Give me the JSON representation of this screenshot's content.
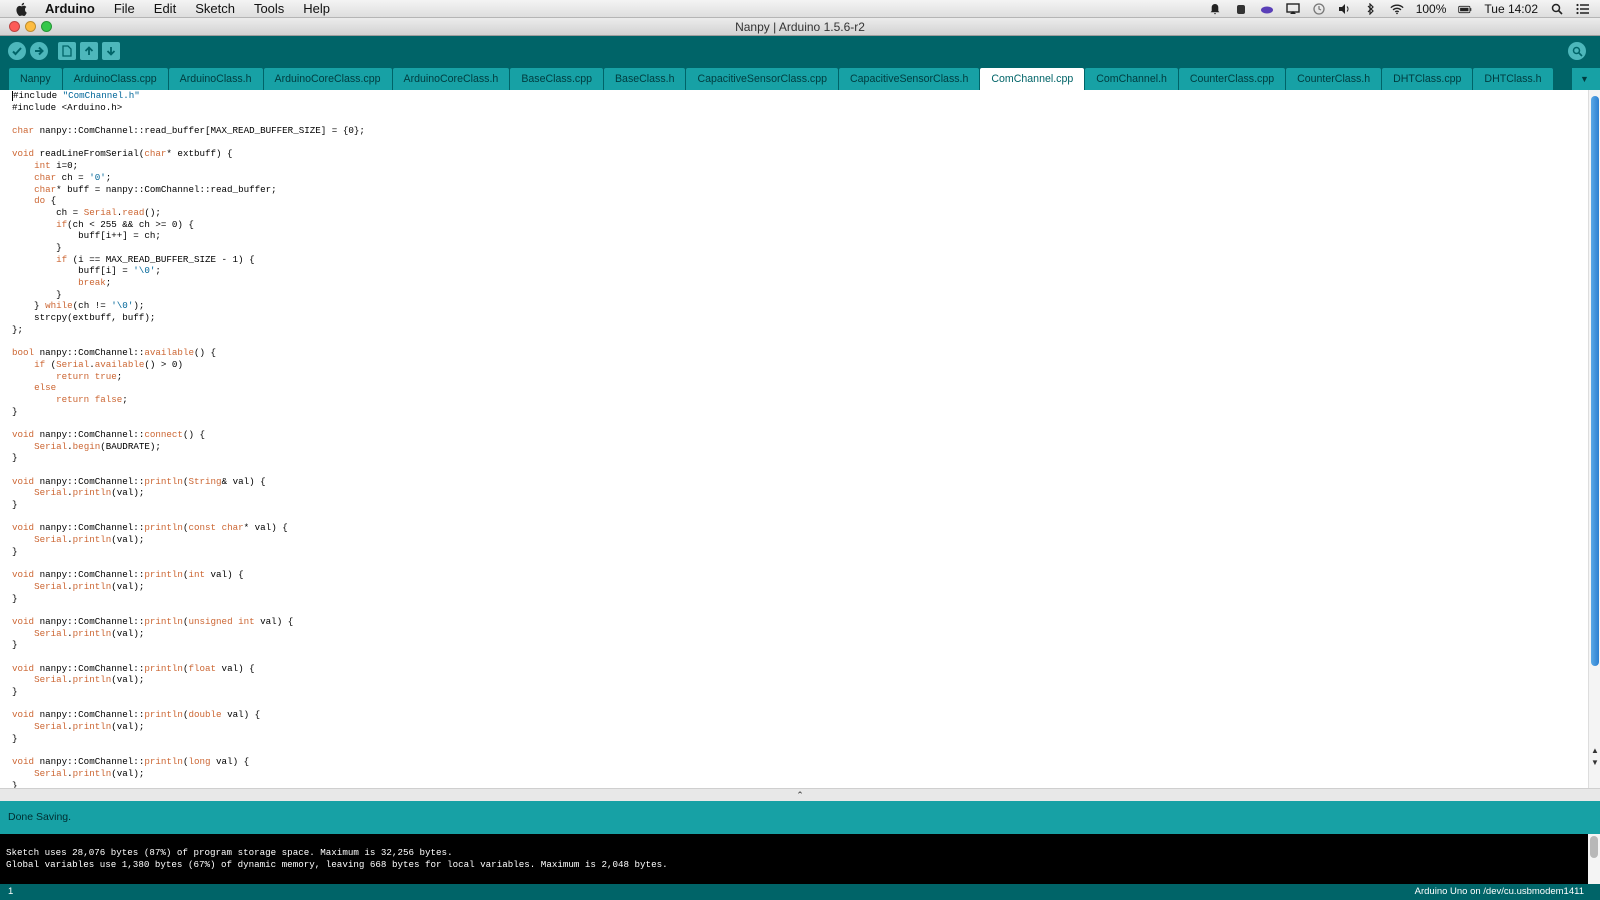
{
  "menubar": {
    "app": "Arduino",
    "items": [
      "File",
      "Edit",
      "Sketch",
      "Tools",
      "Help"
    ],
    "battery": "100%",
    "clock": "Tue 14:02"
  },
  "window": {
    "title": "Nanpy | Arduino 1.5.6-r2"
  },
  "tabs": [
    "Nanpy",
    "ArduinoClass.cpp",
    "ArduinoClass.h",
    "ArduinoCoreClass.cpp",
    "ArduinoCoreClass.h",
    "BaseClass.cpp",
    "BaseClass.h",
    "CapacitiveSensorClass.cpp",
    "CapacitiveSensorClass.h",
    "ComChannel.cpp",
    "ComChannel.h",
    "CounterClass.cpp",
    "CounterClass.h",
    "DHTClass.cpp",
    "DHTClass.h"
  ],
  "active_tab": "ComChannel.cpp",
  "code_lines": [
    "#include \"ComChannel.h\"",
    "#include <Arduino.h>",
    "",
    "char nanpy::ComChannel::read_buffer[MAX_READ_BUFFER_SIZE] = {0};",
    "",
    "void readLineFromSerial(char* extbuff) {",
    "    int i=0;",
    "    char ch = '0';",
    "    char* buff = nanpy::ComChannel::read_buffer;",
    "    do {",
    "        ch = Serial.read();",
    "        if(ch < 255 && ch >= 0) {",
    "            buff[i++] = ch;",
    "        }",
    "        if (i == MAX_READ_BUFFER_SIZE - 1) {",
    "            buff[i] = '\\0';",
    "            break;",
    "        }",
    "    } while(ch != '\\0');",
    "    strcpy(extbuff, buff);",
    "};",
    "",
    "bool nanpy::ComChannel::available() {",
    "    if (Serial.available() > 0)",
    "        return true;",
    "    else",
    "        return false;",
    "}",
    "",
    "void nanpy::ComChannel::connect() {",
    "    Serial.begin(BAUDRATE);",
    "}",
    "",
    "void nanpy::ComChannel::println(String& val) {",
    "    Serial.println(val);",
    "}",
    "",
    "void nanpy::ComChannel::println(const char* val) {",
    "    Serial.println(val);",
    "}",
    "",
    "void nanpy::ComChannel::println(int val) {",
    "    Serial.println(val);",
    "}",
    "",
    "void nanpy::ComChannel::println(unsigned int val) {",
    "    Serial.println(val);",
    "}",
    "",
    "void nanpy::ComChannel::println(float val) {",
    "    Serial.println(val);",
    "}",
    "",
    "void nanpy::ComChannel::println(double val) {",
    "    Serial.println(val);",
    "}",
    "",
    "void nanpy::ComChannel::println(long val) {",
    "    Serial.println(val);",
    "}"
  ],
  "status": {
    "message": "Done Saving."
  },
  "console": [
    "Sketch uses 28,076 bytes (87%) of program storage space. Maximum is 32,256 bytes.",
    "Global variables use 1,380 bytes (67%) of dynamic memory, leaving 668 bytes for local variables. Maximum is 2,048 bytes."
  ],
  "footer": {
    "line": "1",
    "board": "Arduino Uno on /dev/cu.usbmodem1411"
  },
  "colors": {
    "teal_dark": "#006468",
    "teal": "#17a1a5",
    "keyword": "#cc6633",
    "string": "#006699"
  }
}
